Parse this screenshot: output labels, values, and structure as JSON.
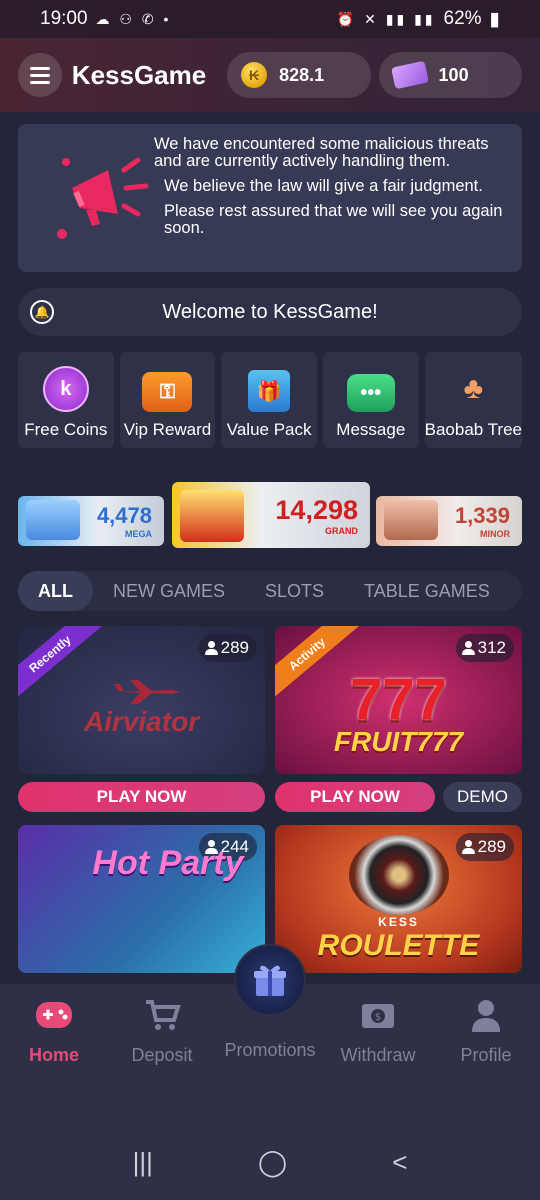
{
  "status_bar": {
    "time": "19:00",
    "battery": "62%"
  },
  "header": {
    "title": "KessGame",
    "coins": "828.1",
    "tickets": "100"
  },
  "notice": {
    "lines": [
      "We have encountered some malicious threats and are currently actively handling them.",
      "We believe the law will give a fair judgment.",
      "Please rest assured that we will see you again soon."
    ]
  },
  "welcome": {
    "text": "Welcome to KessGame!"
  },
  "features": [
    {
      "label": "Free Coins",
      "icon": "k"
    },
    {
      "label": "Vip Reward"
    },
    {
      "label": "Value Pack"
    },
    {
      "label": "Message"
    },
    {
      "label": "Baobab Tree"
    }
  ],
  "jackpots": {
    "mega": {
      "value": "4,478",
      "label": "MEGA"
    },
    "grand": {
      "value": "14,298",
      "label": "GRAND"
    },
    "minor": {
      "value": "1,339",
      "label": "MINOR"
    }
  },
  "tabs": [
    "ALL",
    "NEW GAMES",
    "SLOTS",
    "TABLE GAMES"
  ],
  "games": [
    {
      "title": "Airviator",
      "players": "289",
      "ribbon": "Recently",
      "play": "PLAY NOW"
    },
    {
      "title": "FRUIT777",
      "players": "312",
      "ribbon": "Activity",
      "play": "PLAY NOW",
      "demo": "DEMO",
      "sevens": "777"
    },
    {
      "title": "Hot Party",
      "players": "244"
    },
    {
      "title": "ROULETTE",
      "subtitle": "KESS",
      "players": "289"
    }
  ],
  "bottom_nav": [
    "Home",
    "Deposit",
    "Promotions",
    "Withdraw",
    "Profile"
  ],
  "colors": {
    "accent": "#e84a78",
    "background": "#23253a"
  }
}
